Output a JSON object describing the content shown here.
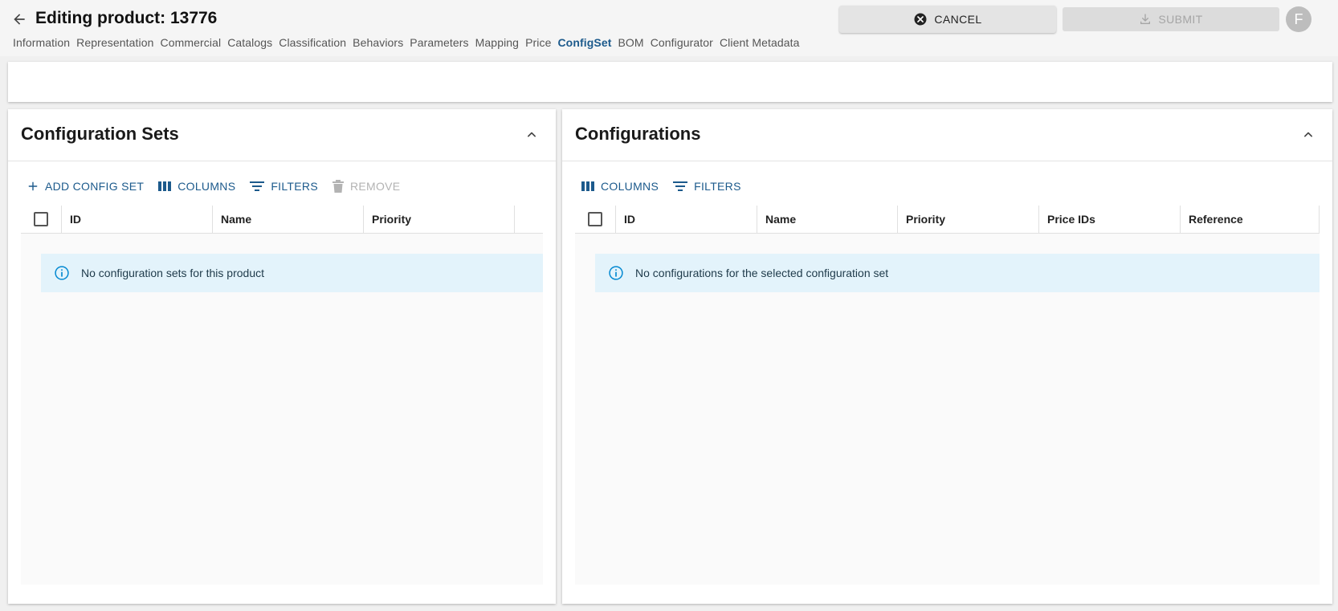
{
  "header": {
    "title": "Editing product: 13776",
    "cancel_label": "CANCEL",
    "submit_label": "SUBMIT",
    "avatar_letter": "F"
  },
  "tabs": [
    {
      "label": "Information"
    },
    {
      "label": "Representation"
    },
    {
      "label": "Commercial"
    },
    {
      "label": "Catalogs"
    },
    {
      "label": "Classification"
    },
    {
      "label": "Behaviors"
    },
    {
      "label": "Parameters"
    },
    {
      "label": "Mapping"
    },
    {
      "label": "Price"
    },
    {
      "label": "ConfigSet",
      "active": true
    },
    {
      "label": "BOM"
    },
    {
      "label": "Configurator"
    },
    {
      "label": "Client Metadata"
    }
  ],
  "left_panel": {
    "title": "Configuration Sets",
    "toolbar": {
      "add": "ADD CONFIG SET",
      "columns": "COLUMNS",
      "filters": "FILTERS",
      "remove": "REMOVE"
    },
    "columns": [
      "ID",
      "Name",
      "Priority"
    ],
    "empty_message": "No configuration sets for this product"
  },
  "right_panel": {
    "title": "Configurations",
    "toolbar": {
      "columns": "COLUMNS",
      "filters": "FILTERS"
    },
    "columns": [
      "ID",
      "Name",
      "Priority",
      "Price IDs",
      "Reference"
    ],
    "empty_message": "No configurations for the selected configuration set"
  },
  "colors": {
    "accent": "#1c5a8c",
    "info_bg": "#e3f3fb",
    "info_icon": "#0288d1"
  }
}
